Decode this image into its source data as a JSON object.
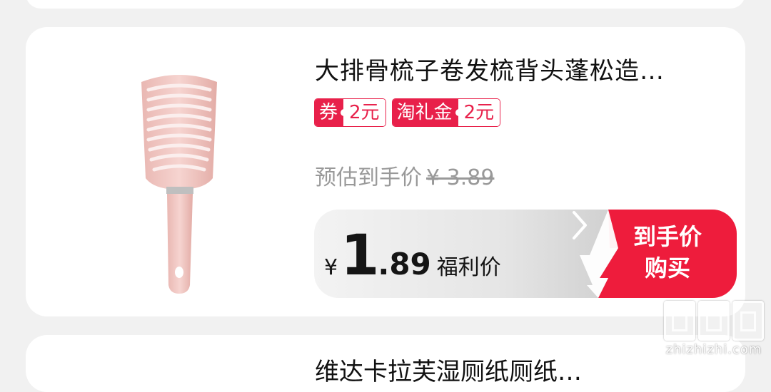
{
  "product": {
    "title": "大排骨梳子卷发梳背头蓬松造…",
    "tags": [
      {
        "label": "券",
        "value": "2元"
      },
      {
        "label": "淘礼金",
        "value": "2元"
      }
    ],
    "estimate_label": "预估到手价",
    "original_price": "¥ 3.89",
    "price": {
      "currency": "¥",
      "integer": "1",
      "decimal": ".89",
      "label": "福利价"
    },
    "buy_button": {
      "line1": "到手价",
      "line2": "购买"
    }
  },
  "next_product": {
    "title": "维达卡拉芙湿厕纸厕纸…"
  },
  "watermark": {
    "site": "zhizhizhi.com"
  },
  "colors": {
    "accent": "#e8204a",
    "button_red": "#ee1c3c"
  }
}
